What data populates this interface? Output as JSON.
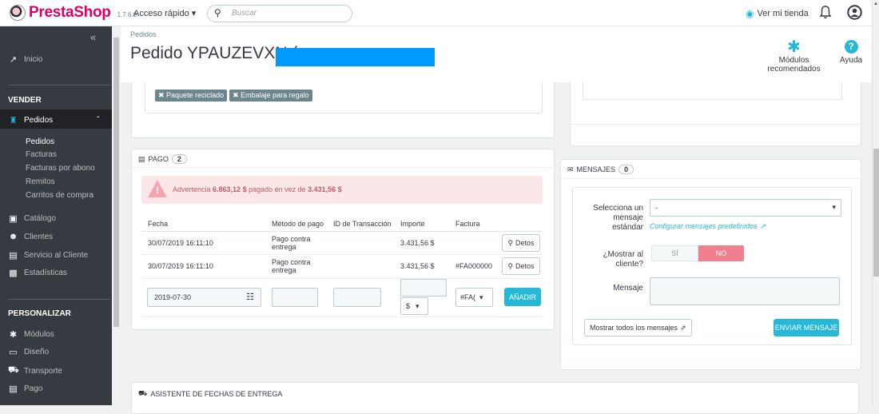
{
  "topbar": {
    "logo_text": "PrestaShop",
    "version": "1.7.6.0",
    "quick_access": "Acceso rápido ▾",
    "search_placeholder": "Buscar",
    "view_store": "Ver mi tienda"
  },
  "sidebar": {
    "inicio": "Inicio",
    "sec_vender": "VENDER",
    "pedidos": "Pedidos",
    "sub": [
      "Pedidos",
      "Facturas",
      "Facturas por abono",
      "Remitos",
      "Carritos de compra"
    ],
    "catalogo": "Catálogo",
    "clientes": "Clientes",
    "servicio": "Servicio al Cliente",
    "estadisticas": "Estadísticas",
    "sec_personalizar": "PERSONALIZAR",
    "modulos": "Módulos",
    "diseno": "Diseño",
    "transporte": "Transporte",
    "pago": "Pago"
  },
  "header": {
    "breadcrumb": "Pedidos",
    "title": "Pedido YPAUZEVXN (",
    "modules": "Módulos recomendados",
    "help": "Ayuda"
  },
  "shipping_panel": {
    "tag1": "✖ Paquete reciclado",
    "tag2": "✖ Embalaje para regalo"
  },
  "payment": {
    "heading": "PAGO",
    "count": "2",
    "warning_prefix": "Advertencia ",
    "warning_amount1": "6.863,12 $",
    "warning_mid": " pagado en vez de ",
    "warning_amount2": "3.431,56 $",
    "columns": [
      "Fecha",
      "Método de pago",
      "ID de Transacción",
      "Importe",
      "Factura"
    ],
    "rows": [
      {
        "fecha": "30/07/2019 16:11:10",
        "metodo": "Pago contra entrega",
        "importe": "3.431,56 $",
        "factura": "",
        "btn": "Detos"
      },
      {
        "fecha": "30/07/2019 16:11:10",
        "metodo": "Pago contra entrega",
        "importe": "3.431,56 $",
        "factura": "#FA000000",
        "btn": "Detos"
      }
    ],
    "new_date": "2019-07-30",
    "currency": "$",
    "invoice_select": "#FA(",
    "add_button": "AÑADIR"
  },
  "messages": {
    "heading": "MENSAJES",
    "count": "0",
    "select_label": "Selecciona un mensaje estándar",
    "select_value": "-",
    "predefined_link": "Configurar mensajes predefinidos",
    "show_label": "¿Mostrar al cliente?",
    "yes": "SÍ",
    "no": "NO",
    "message_label": "Mensaje",
    "show_all": "Mostrar todos los mensajes",
    "send": "ENVIAR MENSAJE"
  },
  "delivery": {
    "heading": "ASISTENTE DE FECHAS DE ENTREGA"
  },
  "colors": {
    "accent": "#25b9d7",
    "brand": "#df0067",
    "sidebar": "#363a41",
    "warning_bg": "#fbe6e8",
    "toggle_no": "#f0808f"
  }
}
